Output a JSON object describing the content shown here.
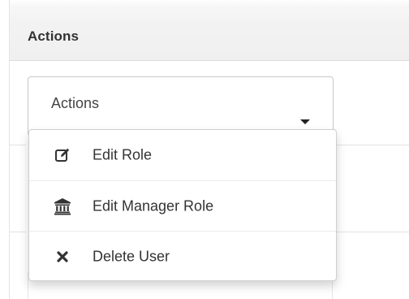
{
  "header": {
    "title": "Actions"
  },
  "actions_select": {
    "selected_label": "Actions"
  },
  "menu": {
    "items": [
      {
        "label": "Edit Role",
        "icon": "edit-icon"
      },
      {
        "label": "Edit Manager Role",
        "icon": "institution-icon"
      },
      {
        "label": "Delete User",
        "icon": "close-icon"
      }
    ]
  }
}
